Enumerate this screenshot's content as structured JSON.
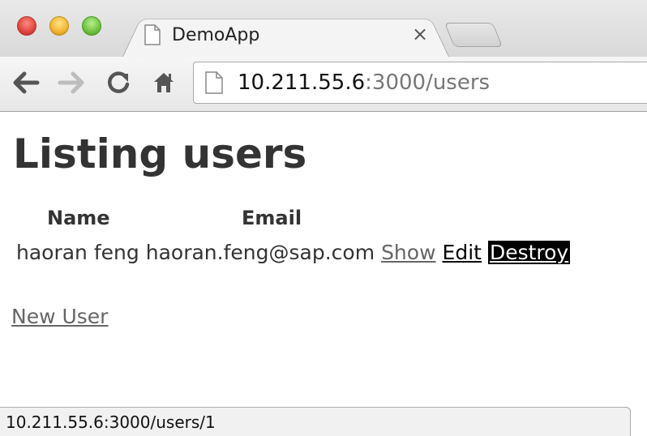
{
  "browser": {
    "tab": {
      "title": "DemoApp",
      "close_glyph": "×"
    },
    "address": {
      "host": "10.211.55.6",
      "rest": ":3000/users"
    },
    "status_url": "10.211.55.6:3000/users/1",
    "icons": [
      "close-window-icon",
      "minimize-window-icon",
      "zoom-window-icon",
      "page-icon",
      "tab-close-icon",
      "back-icon",
      "forward-icon",
      "reload-icon",
      "home-icon"
    ]
  },
  "page": {
    "title": "Listing users",
    "table": {
      "headers": {
        "name": "Name",
        "email": "Email"
      },
      "rows": [
        {
          "name": "haoran feng",
          "email": "haoran.feng@sap.com",
          "show": "Show",
          "edit": "Edit",
          "destroy": "Destroy"
        }
      ]
    },
    "new_user_link": "New User"
  },
  "colors": {
    "text": "#333333",
    "visited_link": "#666666",
    "destroy_bg": "#000000"
  }
}
